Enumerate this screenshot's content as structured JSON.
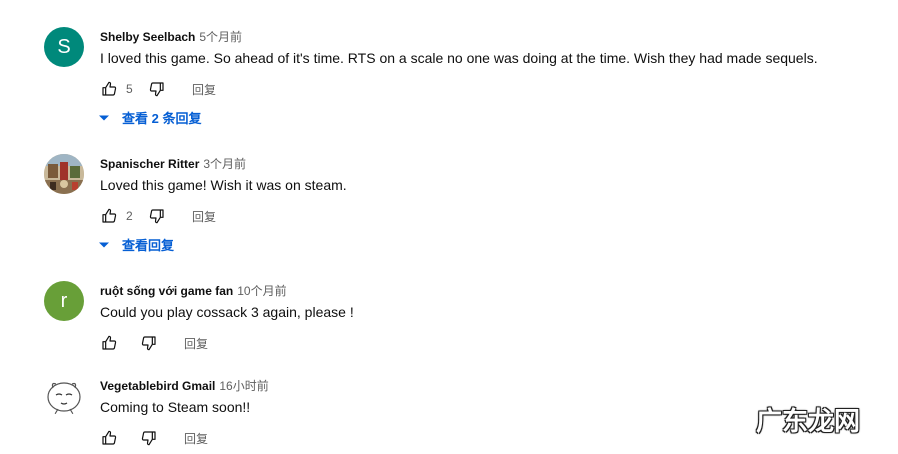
{
  "comments": [
    {
      "author": "Shelby Seelbach",
      "time": "5个月前",
      "text": "I loved this game. So ahead of it's time. RTS on a scale no one was doing at the time. Wish they had made sequels.",
      "likes": "5",
      "reply_label": "回复",
      "view_replies": "查看 2 条回复",
      "avatar_letter": "S",
      "avatar_color": "#00897b"
    },
    {
      "author": "Spanischer Ritter",
      "time": "3个月前",
      "text": "Loved this game! Wish it was on steam.",
      "likes": "2",
      "reply_label": "回复",
      "view_replies": "查看回复",
      "avatar_icon": "painting-avatar-icon"
    },
    {
      "author": "ruột sống với game fan",
      "time": "10个月前",
      "text": "Could you play cossack 3 again, please !",
      "reply_label": "回复",
      "avatar_letter": "r",
      "avatar_color": "#689f38"
    },
    {
      "author": "Vegetablebird Gmail",
      "time": "16小时前",
      "text": "Coming to Steam soon!!",
      "reply_label": "回复",
      "avatar_icon": "cartoon-face-avatar-icon"
    }
  ],
  "watermark": "广东龙网"
}
